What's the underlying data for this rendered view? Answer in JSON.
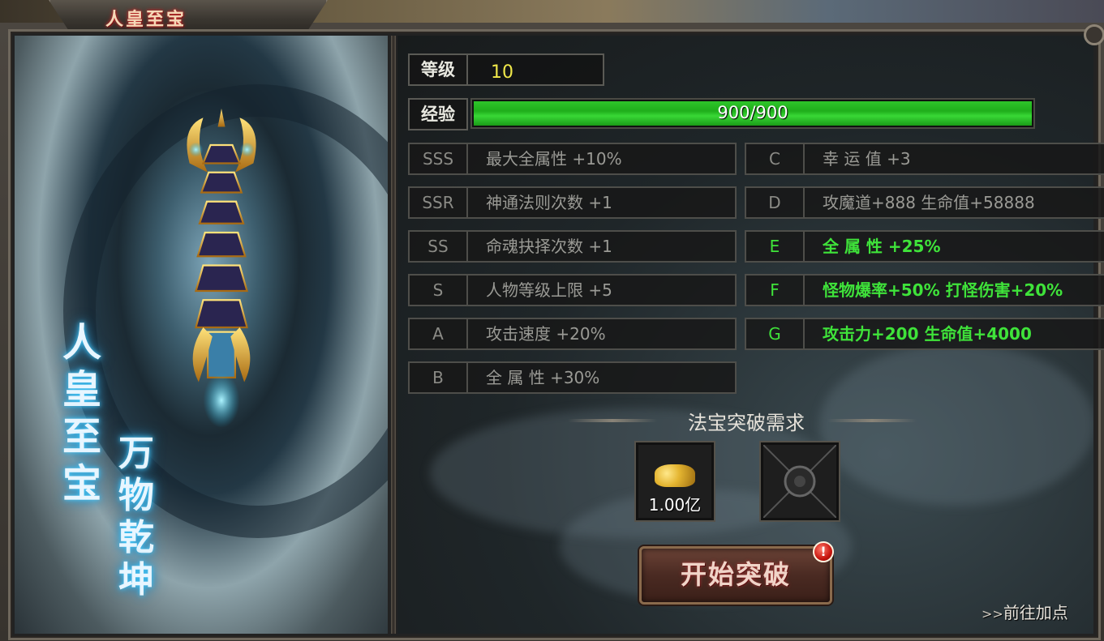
{
  "window": {
    "title": "人皇至宝"
  },
  "artwork": {
    "calligraphy_left": [
      "人",
      "皇",
      "至",
      "宝"
    ],
    "calligraphy_right": [
      "万",
      "物",
      "乾",
      "坤"
    ]
  },
  "level": {
    "label": "等级",
    "value": "10"
  },
  "experience": {
    "label": "经验",
    "text": "900/900",
    "progress": 1.0
  },
  "tiers_left": [
    {
      "grade": "SSS",
      "bonus": "最大全属性 +10%",
      "active": false
    },
    {
      "grade": "SSR",
      "bonus": "神通法则次数 +1",
      "active": false
    },
    {
      "grade": "SS",
      "bonus": "命魂抉择次数 +1",
      "active": false
    },
    {
      "grade": "S",
      "bonus": "人物等级上限 +5",
      "active": false
    },
    {
      "grade": "A",
      "bonus": "攻击速度 +20%",
      "active": false
    },
    {
      "grade": "B",
      "bonus": "全 属 性 +30%",
      "active": false
    }
  ],
  "tiers_right": [
    {
      "grade": "C",
      "bonus": "幸 运 值 +3",
      "active": false
    },
    {
      "grade": "D",
      "bonus": "攻魔道+888 生命值+58888",
      "active": false
    },
    {
      "grade": "E",
      "bonus": "全 属 性 +25%",
      "active": true
    },
    {
      "grade": "F",
      "bonus": "怪物爆率+50% 打怪伤害+20%",
      "active": true
    },
    {
      "grade": "G",
      "bonus": "攻击力+200 生命值+4000",
      "active": true
    }
  ],
  "requirements": {
    "title": "法宝突破需求",
    "items": [
      {
        "icon": "gold-coins-icon",
        "amount": "1.00亿"
      },
      {
        "icon": "empty-slot-icon",
        "amount": ""
      }
    ]
  },
  "actions": {
    "start_breakthrough": "开始突破",
    "alert_badge": "!",
    "goto_points_arrows": ">>",
    "goto_points_label": "前往加点"
  },
  "colors": {
    "active_bonus": "#3fe33a",
    "inactive_bonus": "#9a9a95",
    "level_value": "#f0e84a",
    "exp_bar": "#2ec52a"
  }
}
